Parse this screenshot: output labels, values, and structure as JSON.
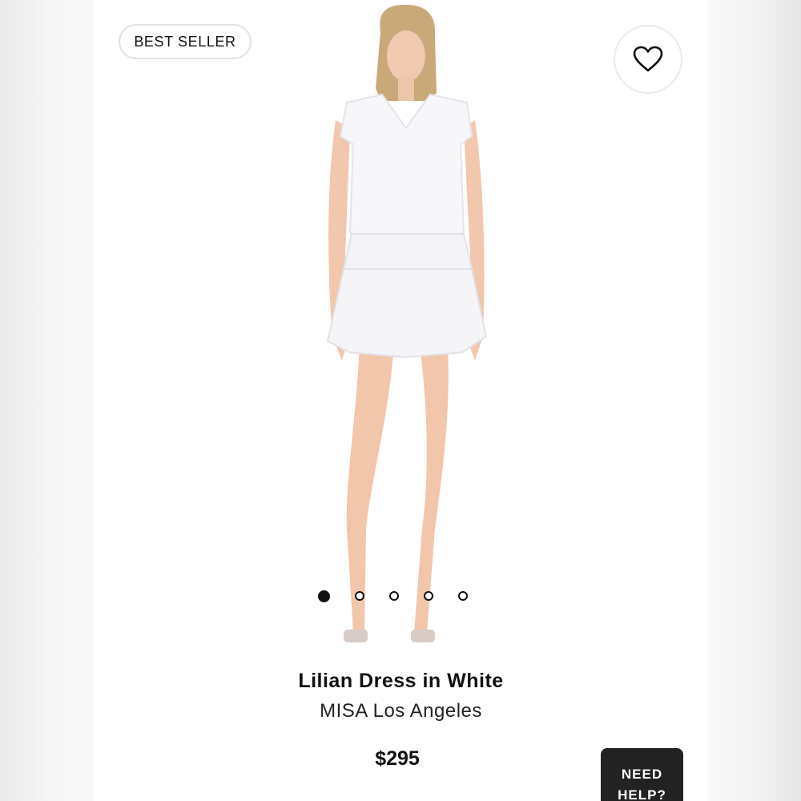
{
  "badge": {
    "label": "BEST SELLER"
  },
  "favorite": {
    "icon": "heart-outline-icon"
  },
  "product": {
    "name": "Lilian Dress in White",
    "brand": "MISA Los Angeles",
    "price": "$295",
    "image": "model-in-white-ruffle-mini-dress"
  },
  "carousel": {
    "count": 5,
    "active_index": 0
  },
  "help_button": {
    "line1": "NEED",
    "line2": "HELP?"
  },
  "colors": {
    "accent": "#111111",
    "help_bg": "#222222"
  }
}
